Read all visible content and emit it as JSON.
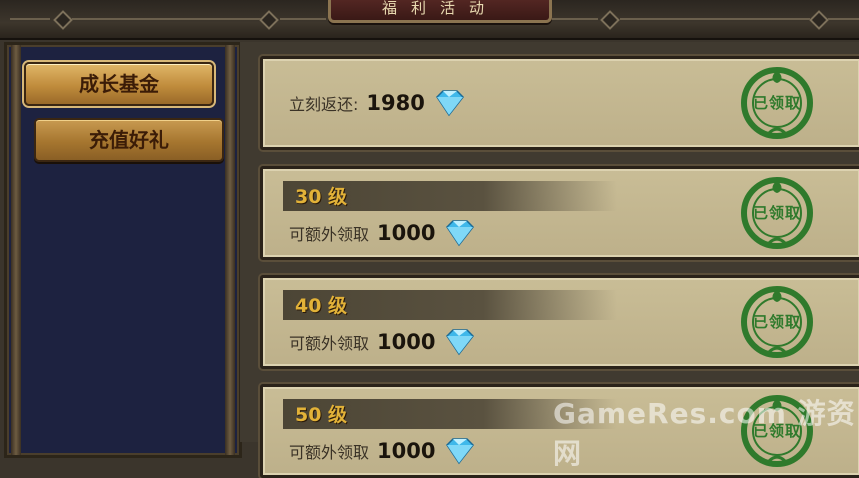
{
  "header": {
    "title": "福利活动"
  },
  "sidebar": {
    "tabs": [
      {
        "label": "成长基金",
        "active": true
      },
      {
        "label": "充值好礼",
        "active": false
      }
    ]
  },
  "rewards": [
    {
      "level": "",
      "text": "立刻返还:",
      "amount": "1980",
      "status": "已领取"
    },
    {
      "level": "30 级",
      "text": "可额外领取",
      "amount": "1000",
      "status": "已领取"
    },
    {
      "level": "40 级",
      "text": "可额外领取",
      "amount": "1000",
      "status": "已领取"
    },
    {
      "level": "50 级",
      "text": "可额外领取",
      "amount": "1000",
      "status": "已领取"
    }
  ],
  "watermark": "GameRes.com 游资网",
  "colors": {
    "stamp": "#2f7a2c",
    "level_gold": "#e2b238",
    "diamond": "#3fb8ea"
  }
}
